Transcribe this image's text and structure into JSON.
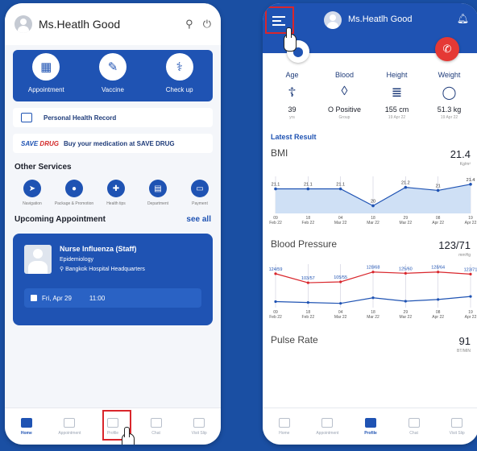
{
  "left": {
    "header": {
      "user_name": "Ms.Heatlh Good",
      "search_icon": "⚲",
      "power_icon": "⏻"
    },
    "features": [
      {
        "label": "Appointment",
        "icon": "▦"
      },
      {
        "label": "Vaccine",
        "icon": "✎"
      },
      {
        "label": "Check up",
        "icon": "⚕"
      }
    ],
    "phr_label": "Personal Health Record",
    "savedrug": {
      "logo_a": "SAVE ",
      "logo_b": "DRUG",
      "label": "Buy your medication at SAVE DRUG"
    },
    "other_services_title": "Other Services",
    "services": [
      {
        "label": "Navigation",
        "icon": "➤"
      },
      {
        "label": "Package & Promotion",
        "icon": "●"
      },
      {
        "label": "Health tips",
        "icon": "✚"
      },
      {
        "label": "Department",
        "icon": "▤"
      },
      {
        "label": "Payment",
        "icon": "▭"
      }
    ],
    "upcoming": {
      "title": "Upcoming Appointment",
      "see_all": "see all"
    },
    "appointment": {
      "name": "Nurse Influenza (Staff)",
      "department": "Epidemiology",
      "location": "Bangkok Hospital Headquarters",
      "date": "Fri, Apr 29",
      "time": "11:00"
    },
    "nav": [
      {
        "label": "Home",
        "active": true
      },
      {
        "label": "Appointment",
        "active": false
      },
      {
        "label": "Profile",
        "active": false
      },
      {
        "label": "Chat",
        "active": false
      },
      {
        "label": "Visit Slip",
        "active": false
      }
    ]
  },
  "right": {
    "header": {
      "user_name": "Ms.Heatlh Good"
    },
    "stats": [
      {
        "label": "Age",
        "icon": "☦",
        "value": "39",
        "sub": "yrs"
      },
      {
        "label": "Blood",
        "icon": "◊",
        "value": "O Positive",
        "sub": "Group"
      },
      {
        "label": "Height",
        "icon": "≣",
        "value": "155 cm",
        "sub": "19 Apr 22"
      },
      {
        "label": "Weight",
        "icon": "◯",
        "value": "51.3 kg",
        "sub": "19 Apr 22"
      }
    ],
    "latest_title": "Latest Result",
    "bmi": {
      "name": "BMI",
      "value": "21.4",
      "unit": "Kg/m²"
    },
    "bp": {
      "name": "Blood Pressure",
      "value": "123/71",
      "unit": "mmHg"
    },
    "pulse": {
      "name": "Pulse Rate",
      "value": "91",
      "unit": "BT/MIN"
    },
    "nav": [
      {
        "label": "Home",
        "active": false
      },
      {
        "label": "Appointment",
        "active": false
      },
      {
        "label": "Profile",
        "active": true
      },
      {
        "label": "Chat",
        "active": false
      },
      {
        "label": "Visit Slip",
        "active": false
      }
    ]
  },
  "chart_data": [
    {
      "type": "line",
      "title": "BMI",
      "x": [
        "09 Feb 22",
        "18 Feb 22",
        "04 Mar 22",
        "18 Mar 22",
        "29 Mar 22",
        "08 Apr 22",
        "19 Apr 22"
      ],
      "series": [
        {
          "values": [
            21.1,
            21.1,
            21.1,
            20,
            21.2,
            21,
            21.4
          ]
        }
      ]
    },
    {
      "type": "line",
      "title": "Blood Pressure",
      "x": [
        "09 Feb 22",
        "18 Feb 22",
        "04 Mar 22",
        "18 Mar 22",
        "29 Mar 22",
        "08 Apr 22",
        "19 Apr 22"
      ],
      "labels": [
        "124/59",
        "103/57",
        "105/55",
        "128/68",
        "125/60",
        "128/64",
        "123/71"
      ],
      "series": [
        {
          "values": [
            124,
            103,
            105,
            128,
            125,
            128,
            123
          ],
          "color": "#d9262c"
        },
        {
          "values": [
            59,
            57,
            55,
            68,
            60,
            64,
            71
          ],
          "color": "#1f53b3"
        }
      ]
    }
  ],
  "colors": {
    "primary": "#1f53b3",
    "accent": "#d9262c",
    "background": "#1a4fa3"
  }
}
